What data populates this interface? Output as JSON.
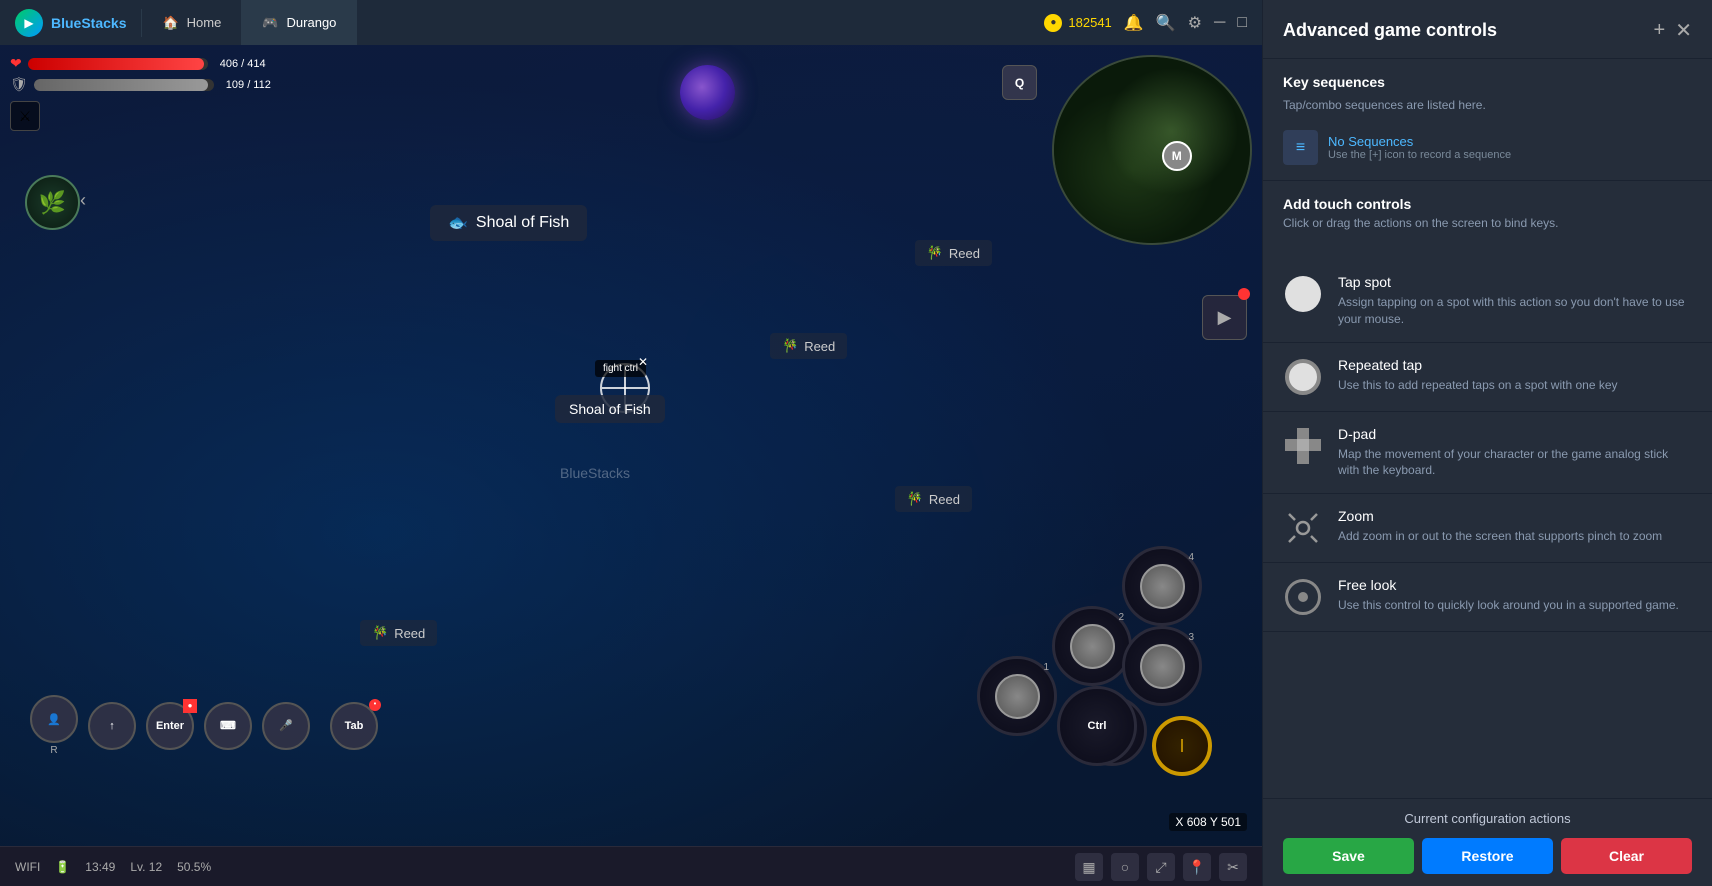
{
  "app": {
    "name": "BlueStacks",
    "logo_emoji": "🎮"
  },
  "tabs": [
    {
      "id": "home",
      "label": "Home",
      "icon": "🏠",
      "active": false
    },
    {
      "id": "durango",
      "label": "Durango",
      "icon": "🎯",
      "active": true
    }
  ],
  "topbar": {
    "coins": "182541",
    "coin_icon": "🪙"
  },
  "hud": {
    "health": "406 / 414",
    "stamina": "109 / 112"
  },
  "map": {
    "coords": "X 608 Y 501",
    "marker": "M"
  },
  "game": {
    "shoal_label": "Shoal of Fish",
    "shoal_center_label": "Shoal of Fish",
    "fight_tooltip": "fight ctrl",
    "reed1": "Reed",
    "reed2": "Reed",
    "reed3": "Reed",
    "bluestacks_watermark": "BlueStacks"
  },
  "statusbar": {
    "wifi": "WIFI",
    "battery": "🔋",
    "time": "13:49",
    "level": "Lv. 12",
    "percent": "50.5%"
  },
  "panel": {
    "title": "Advanced game controls",
    "close_label": "✕",
    "add_label": "+",
    "key_sequences_title": "Key sequences",
    "key_sequences_desc": "Tap/combo sequences are listed here.",
    "no_sequences_label": "No Sequences",
    "no_sequences_sub": "Use the [+] icon to record a sequence",
    "touch_title": "Add touch controls",
    "touch_desc": "Click or drag the actions on the screen to bind keys.",
    "controls": [
      {
        "id": "tap-spot",
        "name": "Tap spot",
        "desc": "Assign tapping on a spot with this action so you don't have to use your mouse.",
        "icon_type": "circle"
      },
      {
        "id": "repeated-tap",
        "name": "Repeated tap",
        "desc": "Use this to add repeated taps on a spot with one key",
        "icon_type": "repeated"
      },
      {
        "id": "dpad",
        "name": "D-pad",
        "desc": "Map the movement of your character or the game analog stick with the keyboard.",
        "icon_type": "dpad"
      },
      {
        "id": "zoom",
        "name": "Zoom",
        "desc": "Add zoom in or out to the screen that supports pinch to zoom",
        "icon_type": "zoom"
      },
      {
        "id": "free-look",
        "name": "Free look",
        "desc": "Use this control to quickly look around you in a supported game.",
        "icon_type": "freelook"
      }
    ],
    "footer": {
      "config_title": "Current configuration actions",
      "save_label": "Save",
      "restore_label": "Restore",
      "clear_label": "Clear"
    }
  }
}
